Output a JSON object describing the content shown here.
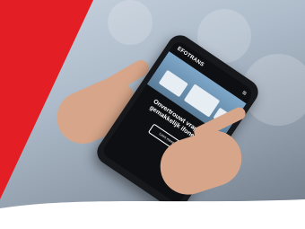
{
  "scene": {
    "description_visible": "",
    "accent_color": "#e31e24",
    "phone_app": {
      "header": {
        "logo_text": "EFOTRANS",
        "menu_icon": "hamburger-icon"
      },
      "hero": {
        "headline": "Onvertrouwt vragens gemakkelijk ifoneren"
      },
      "cta_label": "Lees meer"
    }
  }
}
